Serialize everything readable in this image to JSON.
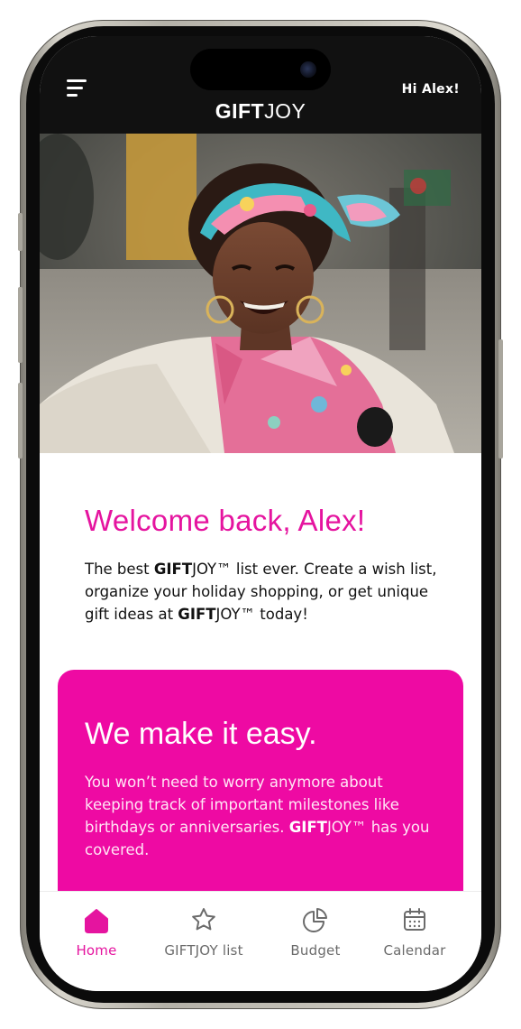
{
  "header": {
    "logo_bold": "GIFT",
    "logo_light": "JOY",
    "greeting": "Hi Alex!"
  },
  "hero": {
    "alt": "Smiling woman with a colorful headscarf and hoop earrings"
  },
  "welcome": {
    "title": "Welcome back, Alex!",
    "intro_1": "The best ",
    "brand_bold": "GIFT",
    "brand_rest": "JOY™",
    "intro_2": " list ever. Create a wish list, organize your holiday shopping, or get unique gift ideas at ",
    "intro_3": " today!"
  },
  "card": {
    "title": "We make it easy.",
    "body_1": "You won’t need to worry anymore about keeping track of important milestones like birthdays or anniversaries. ",
    "body_2": " has you covered."
  },
  "nav": {
    "items": [
      {
        "label": "Home",
        "icon": "home-icon",
        "active": true
      },
      {
        "label": "GIFTJOY list",
        "icon": "star-icon",
        "active": false
      },
      {
        "label": "Budget",
        "icon": "pie-chart-icon",
        "active": false
      },
      {
        "label": "Calendar",
        "icon": "calendar-icon",
        "active": false
      }
    ]
  },
  "colors": {
    "accent": "#e5149f",
    "card": "#ee0aa3",
    "header": "#111111"
  }
}
